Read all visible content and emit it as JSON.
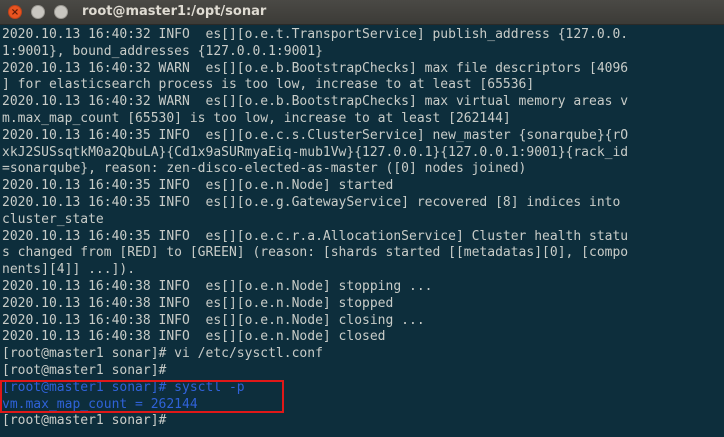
{
  "window": {
    "title": "root@master1:/opt/sonar",
    "controls": {
      "close_label": "×",
      "minimize_label": "",
      "maximize_label": ""
    }
  },
  "terminal": {
    "lines": [
      "2020.10.13 16:40:32 INFO  es[][o.e.t.TransportService] publish_address {127.0.0.",
      "1:9001}, bound_addresses {127.0.0.1:9001}",
      "2020.10.13 16:40:32 WARN  es[][o.e.b.BootstrapChecks] max file descriptors [4096",
      "] for elasticsearch process is too low, increase to at least [65536]",
      "2020.10.13 16:40:32 WARN  es[][o.e.b.BootstrapChecks] max virtual memory areas v",
      "m.max_map_count [65530] is too low, increase to at least [262144]",
      "2020.10.13 16:40:35 INFO  es[][o.e.c.s.ClusterService] new_master {sonarqube}{rO",
      "xkJ2SUSsqtkM0a2QbuLA}{Cd1x9aSURmyaEiq-mub1Vw}{127.0.0.1}{127.0.0.1:9001}{rack_id",
      "=sonarqube}, reason: zen-disco-elected-as-master ([0] nodes joined)",
      "2020.10.13 16:40:35 INFO  es[][o.e.n.Node] started",
      "2020.10.13 16:40:35 INFO  es[][o.e.g.GatewayService] recovered [8] indices into",
      "cluster_state",
      "2020.10.13 16:40:35 INFO  es[][o.e.c.r.a.AllocationService] Cluster health statu",
      "s changed from [RED] to [GREEN] (reason: [shards started [[metadatas][0], [compo",
      "nents][4]] ...]).",
      "2020.10.13 16:40:38 INFO  es[][o.e.n.Node] stopping ...",
      "2020.10.13 16:40:38 INFO  es[][o.e.n.Node] stopped",
      "2020.10.13 16:40:38 INFO  es[][o.e.n.Node] closing ...",
      "2020.10.13 16:40:38 INFO  es[][o.e.n.Node] closed",
      "[root@master1 sonar]# vi /etc/sysctl.conf",
      "[root@master1 sonar]#"
    ],
    "highlighted": [
      "[root@master1 sonar]# sysctl -p",
      "vm.max_map_count = 262144"
    ],
    "prompt": "[root@master1 sonar]#"
  },
  "colors": {
    "terminal_background": "#0d2e3c",
    "text": "#c8ccc8",
    "highlight_text": "#2f62d8",
    "highlight_border": "#e01818",
    "close_button": "#e95420"
  }
}
